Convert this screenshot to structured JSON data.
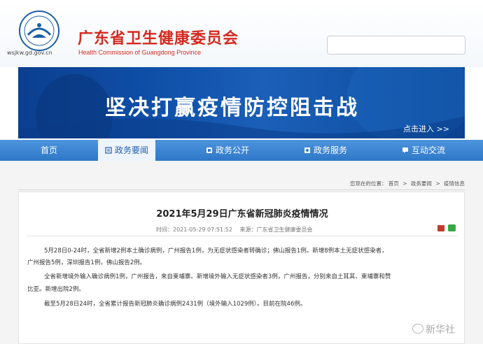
{
  "header": {
    "title_cn": "广东省卫生健康委员会",
    "title_en": "Health Commission of Guangdong Province",
    "domain": "wsjkw.gd.gov.cn",
    "emblem_icon": "gd-health-commission-emblem",
    "search": {
      "placeholder": ""
    }
  },
  "banner": {
    "slogan": "坚决打赢疫情防控阻击战",
    "enter_link": "点击进入 >>"
  },
  "nav": {
    "items": [
      {
        "label": "首页",
        "icon": ""
      },
      {
        "label": "政务要闻",
        "icon": "news-icon"
      },
      {
        "label": "政务公开",
        "icon": "document-icon"
      },
      {
        "label": "政务服务",
        "icon": "service-icon"
      },
      {
        "label": "互动交流",
        "icon": "chat-icon"
      }
    ],
    "active_index": 1
  },
  "breadcrumb": {
    "prefix": "您现在的位置：",
    "items": [
      "首页",
      "政务要闻",
      "疫情信息"
    ],
    "separator": ">"
  },
  "article": {
    "title": "2021年5月29日广东省新冠肺炎疫情情况",
    "time_label": "时间：2021-05-29 07:51:52",
    "source_label": "来源：广东省卫生健康委员会",
    "paragraphs": [
      "5月28日0-24时，全省新增2例本土确诊病例，广州报告1例，为无症状感染者转确诊；佛山报告1例。新增8例本土无症状感染者，",
      "广州报告5例，深圳报告1例，佛山报告2例。",
      "全省新增境外输入确诊病例1例，广州报告，来自柬埔寨。新增境外输入无症状感染者3例，广州报告，分别来自土耳其、柬埔寨和赞",
      "比亚。新增出院2例。",
      "截至5月28日24时，全省累计报告新冠肺炎确诊病例2431例（境外输入1029例）。目前在院46例。"
    ]
  },
  "watermark": {
    "text": "新华社"
  },
  "colors": {
    "brand_red": "#d42a1f",
    "nav_blue": "#2f78c8",
    "banner_blue": "#0f4fa8"
  }
}
